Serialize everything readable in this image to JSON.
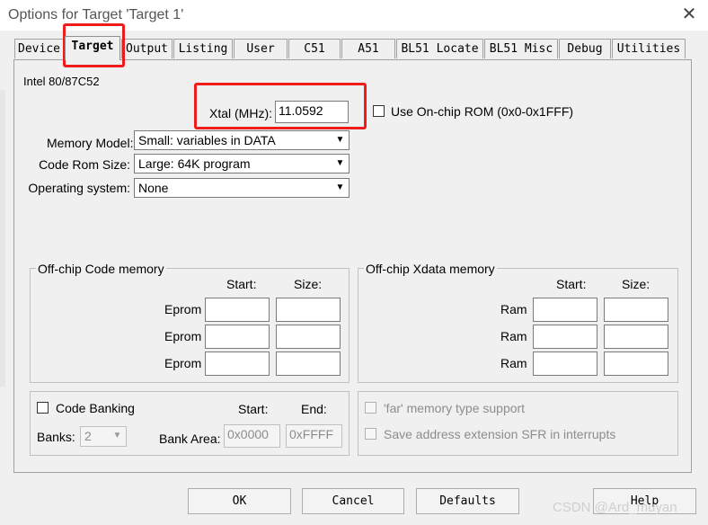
{
  "window": {
    "title": "Options for Target 'Target 1'",
    "close_glyph": "✕"
  },
  "tabs": [
    {
      "label": "Device"
    },
    {
      "label": "Target"
    },
    {
      "label": "Output"
    },
    {
      "label": "Listing"
    },
    {
      "label": "User"
    },
    {
      "label": "C51"
    },
    {
      "label": "A51"
    },
    {
      "label": "BL51 Locate"
    },
    {
      "label": "BL51 Misc"
    },
    {
      "label": "Debug"
    },
    {
      "label": "Utilities"
    }
  ],
  "target": {
    "device_name": "Intel 80/87C52",
    "xtal_label": "Xtal (MHz):",
    "xtal_value": "11.0592",
    "onchip_rom_label": "Use On-chip ROM (0x0-0x1FFF)",
    "memory_model_label": "Memory Model:",
    "memory_model_value": "Small: variables in DATA",
    "code_rom_label": "Code Rom Size:",
    "code_rom_value": "Large: 64K program",
    "os_label": "Operating system:",
    "os_value": "None"
  },
  "code_memory": {
    "title": "Off-chip Code memory",
    "start_header": "Start:",
    "size_header": "Size:",
    "rows": [
      {
        "label": "Eprom"
      },
      {
        "label": "Eprom"
      },
      {
        "label": "Eprom"
      }
    ]
  },
  "xdata_memory": {
    "title": "Off-chip Xdata memory",
    "start_header": "Start:",
    "size_header": "Size:",
    "rows": [
      {
        "label": "Ram"
      },
      {
        "label": "Ram"
      },
      {
        "label": "Ram"
      }
    ]
  },
  "banking": {
    "code_banking_label": "Code Banking",
    "banks_label": "Banks:",
    "banks_value": "2",
    "start_header": "Start:",
    "end_header": "End:",
    "bank_area_label": "Bank Area:",
    "start_value": "0x0000",
    "end_value": "0xFFFF"
  },
  "options": {
    "far_memory_label": "'far' memory type support",
    "save_address_label": "Save address extension SFR in interrupts"
  },
  "buttons": {
    "ok": "OK",
    "cancel": "Cancel",
    "defaults": "Defaults",
    "help": "Help"
  },
  "watermark": "CSDN @Ard_muyan",
  "colors": {
    "highlight": "#ee1c1c",
    "dialog_bg": "#f0f0f0"
  }
}
